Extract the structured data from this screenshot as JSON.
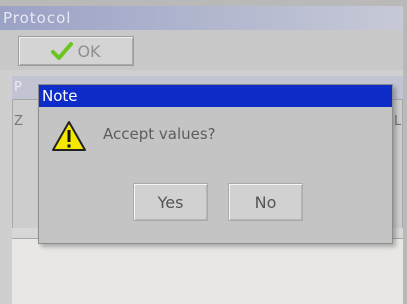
{
  "window": {
    "title": "Protocol"
  },
  "toolbar": {
    "ok_label": "OK"
  },
  "background": {
    "header_left": "P",
    "row_left": "Z",
    "header_right": "L"
  },
  "dialog": {
    "title": "Note",
    "message": "Accept values?",
    "yes_label": "Yes",
    "no_label": "No"
  },
  "icons": {
    "ok": "checkmark-icon",
    "warning": "warning-icon"
  },
  "colors": {
    "dialog_title_bar": "#0e2cc8",
    "check": "#6cc51f",
    "warning": "#f5e800"
  }
}
